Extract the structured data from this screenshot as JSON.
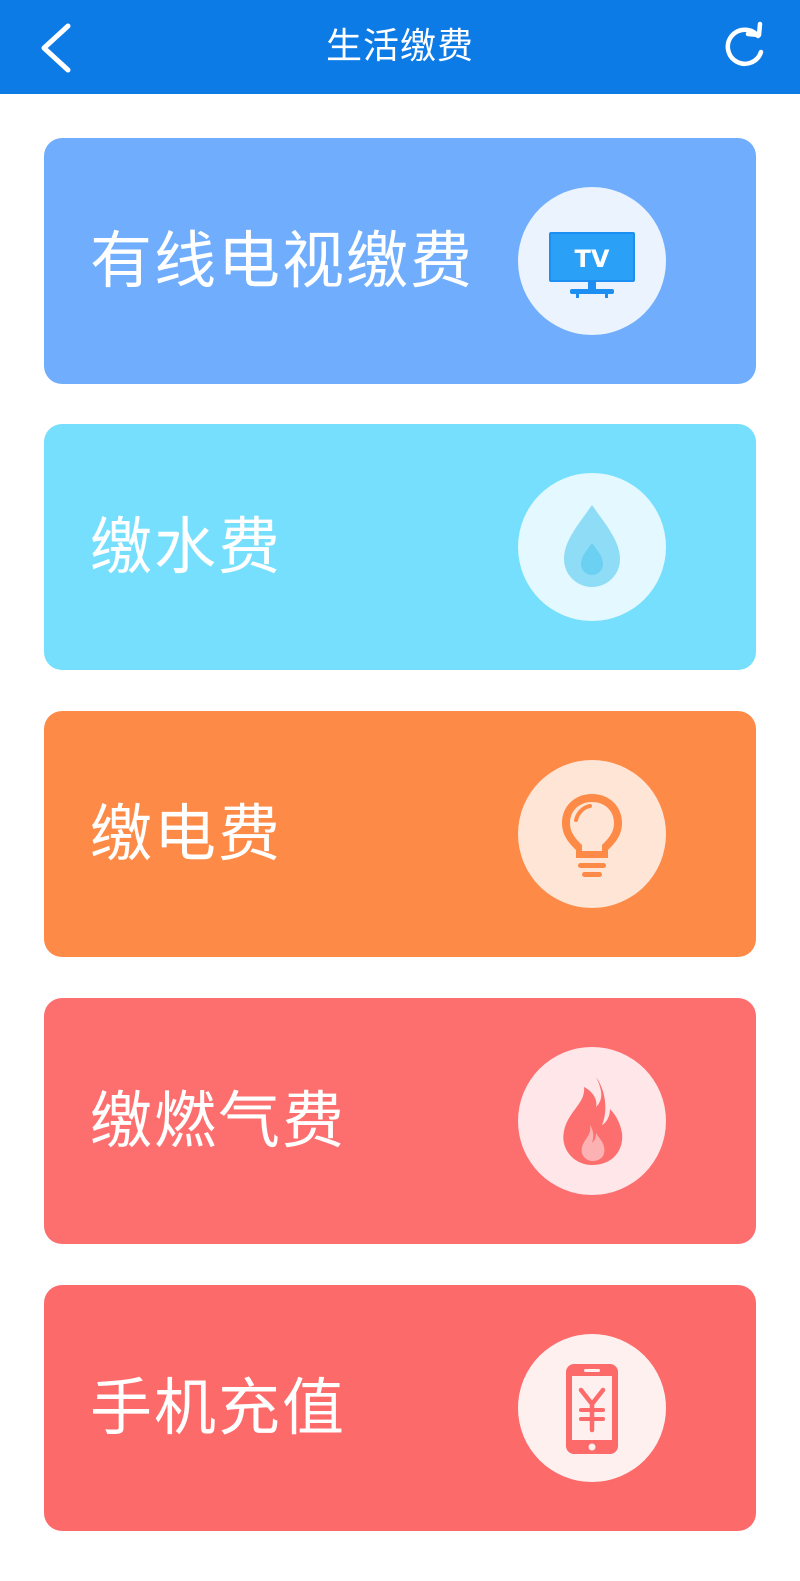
{
  "header": {
    "title": "生活缴费",
    "back_icon": "chevron-left-icon",
    "refresh_icon": "refresh-icon",
    "background_color": "#0c7be6"
  },
  "cards": [
    {
      "label": "有线电视缴费",
      "icon": "tv-icon",
      "color": "#70aefd"
    },
    {
      "label": "缴水费",
      "icon": "water-drop-icon",
      "color": "#75dffd"
    },
    {
      "label": "缴电费",
      "icon": "light-bulb-icon",
      "color": "#fd8a47"
    },
    {
      "label": "缴燃气费",
      "icon": "flame-icon",
      "color": "#fd6f6f"
    },
    {
      "label": "手机充值",
      "icon": "mobile-yuan-icon",
      "color": "#fd6a6a"
    }
  ]
}
